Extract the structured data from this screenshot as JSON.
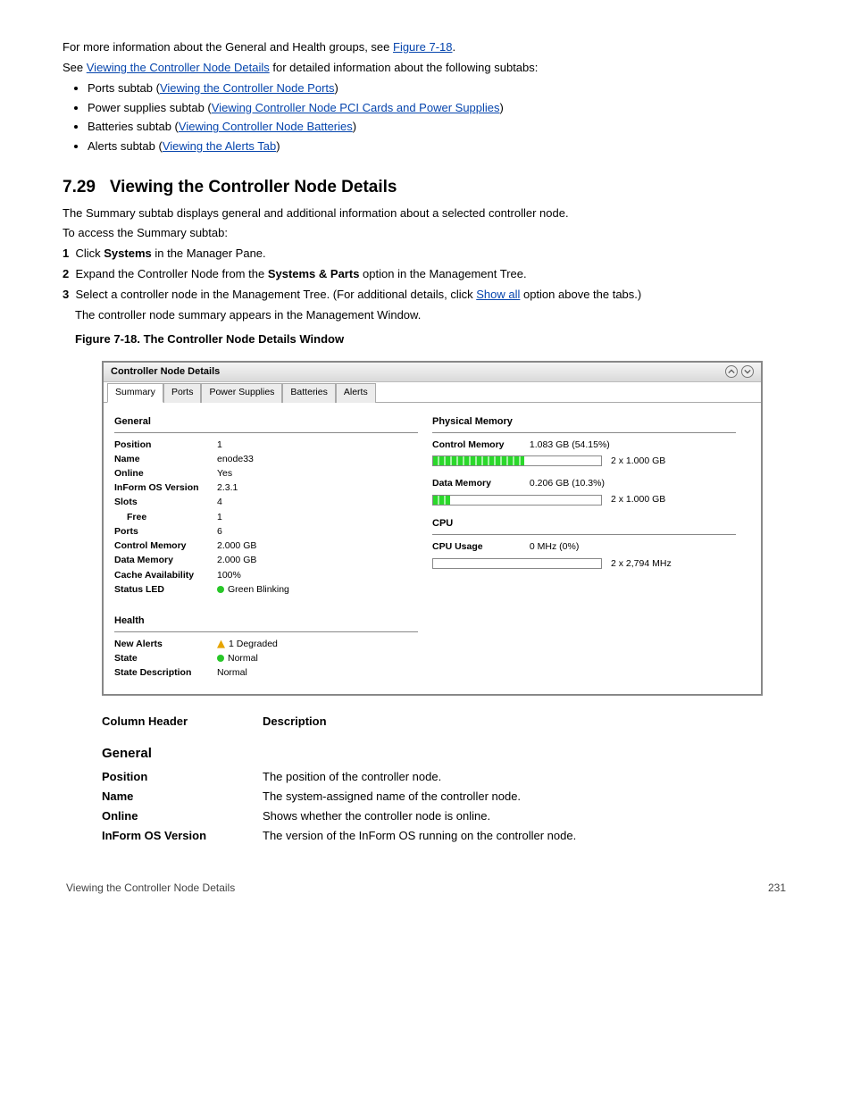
{
  "intro_text": "For more information about the General and Health groups, see ",
  "intro_link": "Figure 7-18",
  "intro_text_after": " for detailed information about the following subtabs:",
  "subtabs_intro": "See ",
  "subtabs_link": "Viewing the Controller Node Details",
  "subtabs_bullets": [
    {
      "prefix": "Ports subtab (",
      "link": "Viewing the Controller Node Ports",
      "suffix": ")"
    },
    {
      "prefix": "Power supplies subtab (",
      "link": "Viewing Controller Node PCI Cards and Power Supplies",
      "suffix": ")"
    },
    {
      "prefix": "Batteries subtab (",
      "link": "Viewing Controller Node Batteries",
      "suffix": ")"
    },
    {
      "prefix": "Alerts subtab (",
      "link": "Viewing the Alerts Tab",
      "suffix": ")"
    }
  ],
  "section_title": "Viewing the Controller Node Details",
  "section_intro": "The Summary subtab displays general and additional information about a selected controller node.",
  "access_intro": "To access the Summary subtab:",
  "steps": [
    {
      "num": "1",
      "text": "Click ",
      "bold": "Systems",
      "after": " in the Manager Pane."
    },
    {
      "num": "2",
      "prefix": "Expand the Controller Node from the ",
      "bold": "Systems & Parts",
      "after": " option in the Management Tree."
    },
    {
      "num": "3",
      "prefix": "Select a controller node in the Management Tree. (For additional details, click ",
      "link": "Show all",
      "suffix": " option above the tabs.)",
      "after": ""
    }
  ],
  "steps_after": "The controller node summary appears in the Management Window.",
  "figure_label": "Figure 7-18.  The Controller Node Details Window",
  "panel": {
    "title": "Controller Node Details",
    "tabs": [
      "Summary",
      "Ports",
      "Power Supplies",
      "Batteries",
      "Alerts"
    ],
    "active_tab": 0,
    "general_header": "General",
    "general_rows": [
      {
        "k": "Position",
        "v": "1"
      },
      {
        "k": "Name",
        "v": "enode33"
      },
      {
        "k": "Online",
        "v": "Yes"
      },
      {
        "k": "InForm OS Version",
        "v": "2.3.1"
      },
      {
        "k": "Slots",
        "v": "4"
      },
      {
        "k": "Free",
        "v": "1",
        "indent": true
      },
      {
        "k": "Ports",
        "v": "6"
      },
      {
        "k": "Control Memory",
        "v": "2.000 GB"
      },
      {
        "k": "Data Memory",
        "v": "2.000 GB"
      },
      {
        "k": "Cache Availability",
        "v": "100%"
      },
      {
        "k": "Status LED",
        "v": "Green Blinking",
        "led": true
      }
    ],
    "health_header": "Health",
    "health_rows": [
      {
        "k": "New Alerts",
        "v": "1 Degraded",
        "alert": true
      },
      {
        "k": "State",
        "v": "Normal",
        "led": true
      },
      {
        "k": "State Description",
        "v": "Normal"
      }
    ],
    "physmem_header": "Physical Memory",
    "control_mem": {
      "label": "Control Memory",
      "usage": "1.083 GB (54.15%)",
      "pct": 54.15,
      "caption": "2 x 1.000 GB"
    },
    "data_mem": {
      "label": "Data Memory",
      "usage": "0.206 GB (10.3%)",
      "pct": 10.3,
      "caption": "2 x 1.000 GB"
    },
    "cpu_header": "CPU",
    "cpu": {
      "label": "CPU Usage",
      "value": "0 MHz (0%)",
      "caption": "2 x 2,794 MHz"
    }
  },
  "post_figure": {
    "col_header_label": "Column Header",
    "col_header_desc": "Description",
    "subsection": "General",
    "rows": [
      {
        "k": "Position",
        "v": "The position of the controller node."
      },
      {
        "k": "Name",
        "v": "The system-assigned name of the controller node."
      },
      {
        "k": "Online",
        "v": "Shows whether the controller node is online."
      },
      {
        "k": "InForm OS Version",
        "v": "The version of the InForm OS running on the controller node."
      }
    ]
  },
  "footer_left": "Viewing the Controller Node Details",
  "footer_right": "231",
  "chapter": "7.29"
}
